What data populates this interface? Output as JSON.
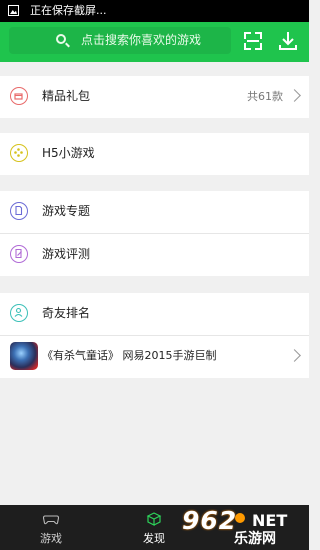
{
  "status_bar": {
    "text": "正在保存截屏..."
  },
  "header": {
    "search_placeholder": "点击搜索你喜欢的游戏",
    "accent_color": "#1fc44d"
  },
  "groups": [
    {
      "items": [
        {
          "label": "精品礼包",
          "count": "共61款",
          "icon": "gift-icon",
          "color": "#e86a6a"
        }
      ]
    },
    {
      "items": [
        {
          "label": "H5小游戏",
          "icon": "gamepad-icon",
          "color": "#d6c21c"
        }
      ]
    },
    {
      "items": [
        {
          "label": "游戏专题",
          "icon": "document-icon",
          "color": "#6b6bd6"
        },
        {
          "label": "游戏评测",
          "icon": "review-icon",
          "color": "#b06bd6"
        }
      ]
    },
    {
      "items": [
        {
          "label": "奇友排名",
          "icon": "user-icon",
          "color": "#3cc0b8"
        }
      ]
    }
  ],
  "promo": {
    "text": "《有杀气童话》 网易2015手游巨制"
  },
  "tabs": [
    {
      "label": "游戏",
      "icon": "gamepad-icon",
      "active": false
    },
    {
      "label": "发现",
      "icon": "cube-icon",
      "active": true
    }
  ],
  "watermark": {
    "number": "962",
    "domain": "NET",
    "brand": "乐游网"
  }
}
